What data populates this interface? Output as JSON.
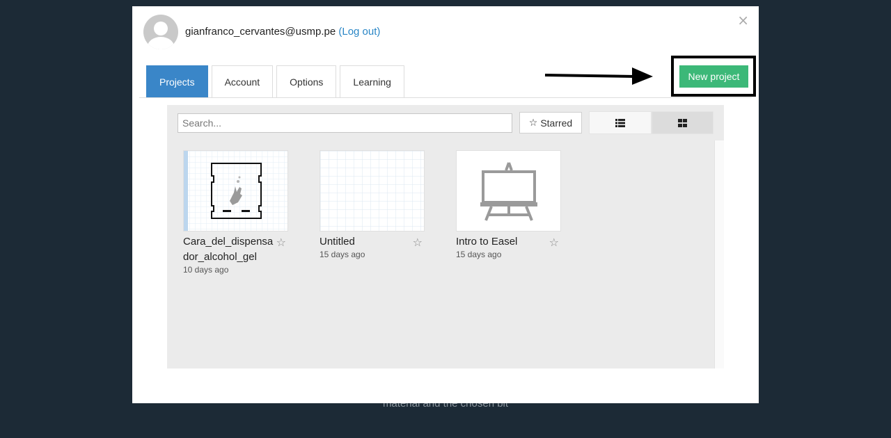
{
  "background": {
    "text": "material and the chosen bit"
  },
  "header": {
    "email": "gianfranco_cervantes@usmp.pe",
    "logout_label": "(Log out)",
    "close_symbol": "×"
  },
  "tabs": [
    {
      "label": "Projects",
      "active": true
    },
    {
      "label": "Account",
      "active": false
    },
    {
      "label": "Options",
      "active": false
    },
    {
      "label": "Learning",
      "active": false
    }
  ],
  "toolbar": {
    "new_project_label": "New project",
    "search_placeholder": "Search...",
    "starred_label": "Starred",
    "view_modes": [
      "list-view-icon",
      "grid-view-icon"
    ],
    "active_view": "grid"
  },
  "projects": [
    {
      "name": "Cara_del_dispensador_alcohol_gel",
      "date": "10 days ago"
    },
    {
      "name": "Untitled",
      "date": "15 days ago"
    },
    {
      "name": "Intro to Easel",
      "date": "15 days ago"
    }
  ],
  "colors": {
    "accent_blue": "#3a86c8",
    "new_project_green": "#3cb878",
    "backdrop": "#1c2a36"
  }
}
